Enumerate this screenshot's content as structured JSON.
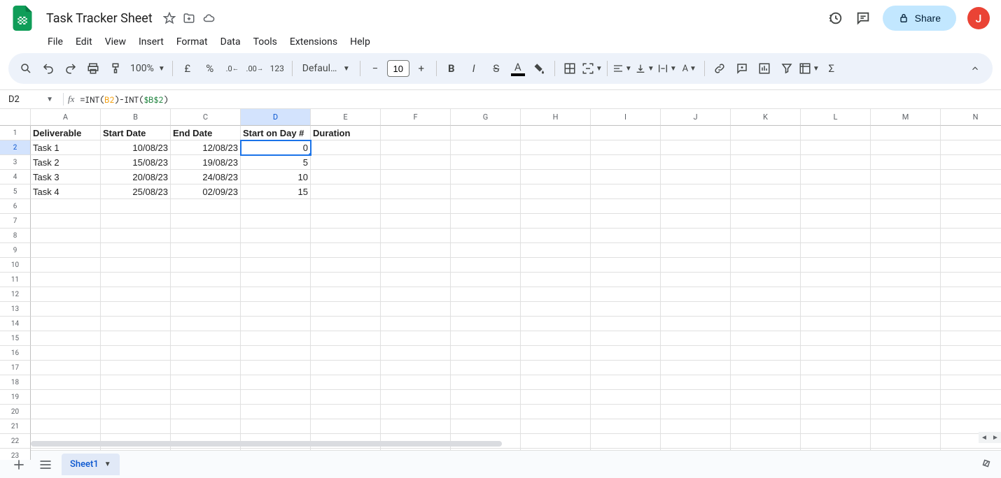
{
  "document": {
    "title": "Task Tracker Sheet",
    "avatar_letter": "J"
  },
  "header_buttons": {
    "share": "Share"
  },
  "menubar": [
    "File",
    "Edit",
    "View",
    "Insert",
    "Format",
    "Data",
    "Tools",
    "Extensions",
    "Help"
  ],
  "toolbar": {
    "zoom": "100%",
    "number_format": "123",
    "font_name": "Defaul…",
    "font_size": "10"
  },
  "formula_bar": {
    "name_box": "D2",
    "formula_raw": "=INT(B2)-INT($B$2)",
    "formula_parts": {
      "p1": "=INT(",
      "ref1": "B2",
      "p2": ")-INT(",
      "ref2": "$B$2",
      "p3": ")"
    }
  },
  "grid": {
    "columns": [
      "A",
      "B",
      "C",
      "D",
      "E",
      "F",
      "G",
      "H",
      "I",
      "J",
      "K",
      "L",
      "M",
      "N"
    ],
    "row_count": 23,
    "active_cell": "D2",
    "active_col": "D",
    "active_row": 2,
    "headers": [
      "Deliverable",
      "Start Date",
      "End Date",
      "Start on Day #",
      "Duration"
    ],
    "rows": [
      {
        "a": "Task 1",
        "b": "10/08/23",
        "c": "12/08/23",
        "d": "0"
      },
      {
        "a": "Task 2",
        "b": "15/08/23",
        "c": "19/08/23",
        "d": "5"
      },
      {
        "a": "Task 3",
        "b": "20/08/23",
        "c": "24/08/23",
        "d": "10"
      },
      {
        "a": "Task 4",
        "b": "25/08/23",
        "c": "02/09/23",
        "d": "15"
      }
    ]
  },
  "sheets": {
    "active": "Sheet1"
  }
}
